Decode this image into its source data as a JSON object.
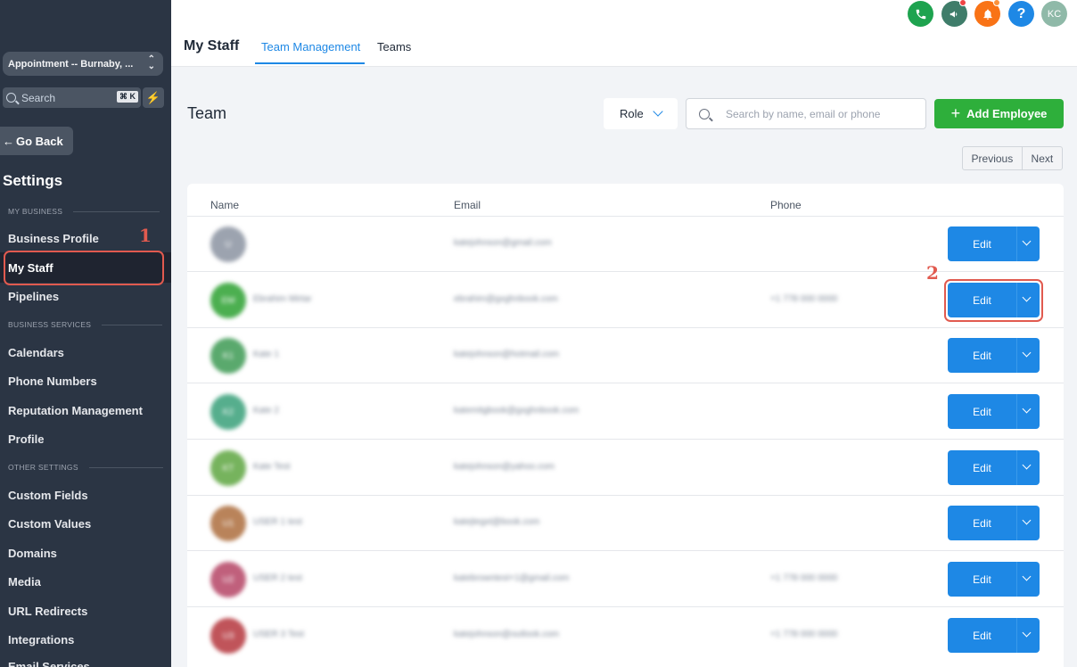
{
  "sidebar": {
    "location": "Appointment -- Burnaby, ...",
    "search_placeholder": "Search",
    "search_shortcut": "⌘ K",
    "go_back": "Go Back",
    "settings_title": "Settings",
    "sections": {
      "my_business": "MY BUSINESS",
      "business_services": "BUSINESS SERVICES",
      "other_settings": "OTHER SETTINGS"
    },
    "items": {
      "business_profile": "Business Profile",
      "my_staff": "My Staff",
      "pipelines": "Pipelines",
      "calendars": "Calendars",
      "phone_numbers": "Phone Numbers",
      "reputation_management": "Reputation Management",
      "profile": "Profile",
      "custom_fields": "Custom Fields",
      "custom_values": "Custom Values",
      "domains": "Domains",
      "media": "Media",
      "url_redirects": "URL Redirects",
      "integrations": "Integrations",
      "email_services": "Email Services"
    }
  },
  "header": {
    "title": "My Staff",
    "tabs": {
      "team_management": "Team Management",
      "teams": "Teams"
    },
    "avatar_initials": "KC",
    "help_label": "?"
  },
  "toolbar": {
    "team_title": "Team",
    "role_label": "Role",
    "search_placeholder": "Search by name, email or phone",
    "add_employee": "Add Employee",
    "previous": "Previous",
    "next": "Next"
  },
  "table": {
    "headers": {
      "name": "Name",
      "email": "Email",
      "phone": "Phone"
    },
    "edit_label": "Edit",
    "rows": [
      {
        "initials": "U",
        "name": "",
        "email": "katejohnson@gmail.com",
        "phone": "",
        "color": "#9ca3af"
      },
      {
        "initials": "EM",
        "name": "Ebrahim Mirtar",
        "email": "ebrahim@gxghnbook.com",
        "phone": "+1 778 000 0000",
        "color": "#4caf50"
      },
      {
        "initials": "K1",
        "name": "Kate 1",
        "email": "katejohnson@hotmail.com",
        "phone": "",
        "color": "#5aa96d"
      },
      {
        "initials": "K2",
        "name": "Kate 2",
        "email": "katemitgbook@gxghnbook.com",
        "phone": "",
        "color": "#56ae8d"
      },
      {
        "initials": "KT",
        "name": "Kate Test",
        "email": "katejohnson@yahoo.com",
        "phone": "",
        "color": "#76b35d"
      },
      {
        "initials": "U1",
        "name": "USER 1 test",
        "email": "katejtegxt@book.com",
        "phone": "",
        "color": "#b9835a"
      },
      {
        "initials": "U2",
        "name": "USER 2 test",
        "email": "katebrowntest+1@gmail.com",
        "phone": "+1 778 000 0000",
        "color": "#c0607c"
      },
      {
        "initials": "U3",
        "name": "USER 3 Test",
        "email": "katejohnson@outlook.com",
        "phone": "+1 778 000 0000",
        "color": "#c0545a"
      }
    ]
  },
  "annotations": {
    "first": "1",
    "second": "2"
  }
}
